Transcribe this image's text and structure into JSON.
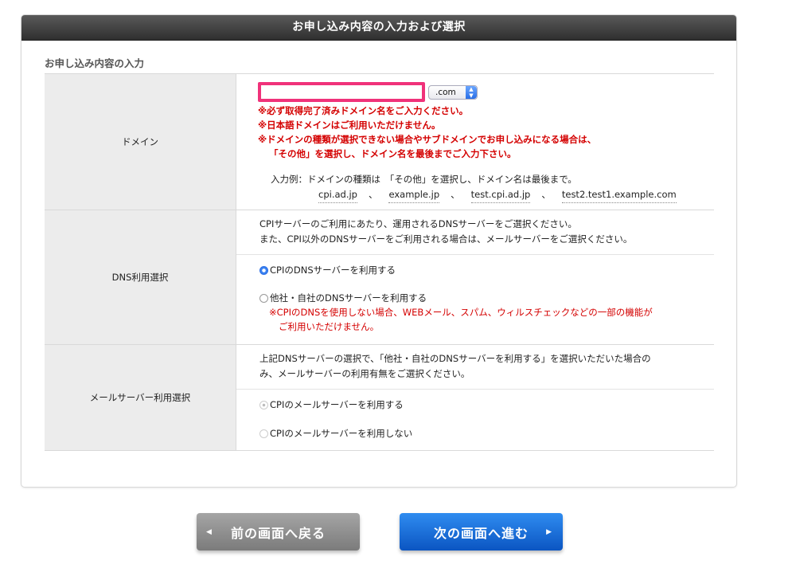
{
  "panel": {
    "header": "お申し込み内容の入力および選択",
    "section_title": "お申し込み内容の入力"
  },
  "domain": {
    "label": "ドメイン",
    "input_value": "",
    "tld_selected": ".com",
    "notes": [
      "※必ず取得完了済みドメイン名をご入力ください。",
      "※日本語ドメインはご利用いただけません。",
      "※ドメインの種類が選択できない場合やサブドメインでお申し込みになる場合は、",
      "「その他」を選択し、ドメイン名を最後までご入力下さい。"
    ],
    "example_intro": "入力例：ドメインの種類は　「その他」を選択し、ドメイン名は最後まで。",
    "examples": [
      "cpi.ad.jp",
      "example.jp",
      "test.cpi.ad.jp",
      "test2.test1.example.com"
    ],
    "example_separator": "、"
  },
  "dns": {
    "label": "DNS利用選択",
    "description_1": "CPIサーバーのご利用にあたり、運用されるDNSサーバーをご選択ください。",
    "description_2": "また、CPI以外のDNSサーバーをご利用される場合は、メールサーバーをご選択ください。",
    "option_cpi": "CPIのDNSサーバーを利用する",
    "option_other": "他社・自社のDNSサーバーを利用する",
    "warning_1": "※CPIのDNSを使用しない場合、WEBメール、スパム、ウィルスチェックなどの一部の機能が",
    "warning_2": "ご利用いただけません。"
  },
  "mail": {
    "label": "メールサーバー利用選択",
    "description_1": "上記DNSサーバーの選択で、「他社・自社のDNSサーバーを利用する」を選択いただいた場合の",
    "description_2": "み、メールサーバーの利用有無をご選択ください。",
    "option_use": "CPIのメールサーバーを利用する",
    "option_not_use": "CPIのメールサーバーを利用しない"
  },
  "buttons": {
    "back": "前の画面へ戻る",
    "next": "次の画面へ進む"
  }
}
